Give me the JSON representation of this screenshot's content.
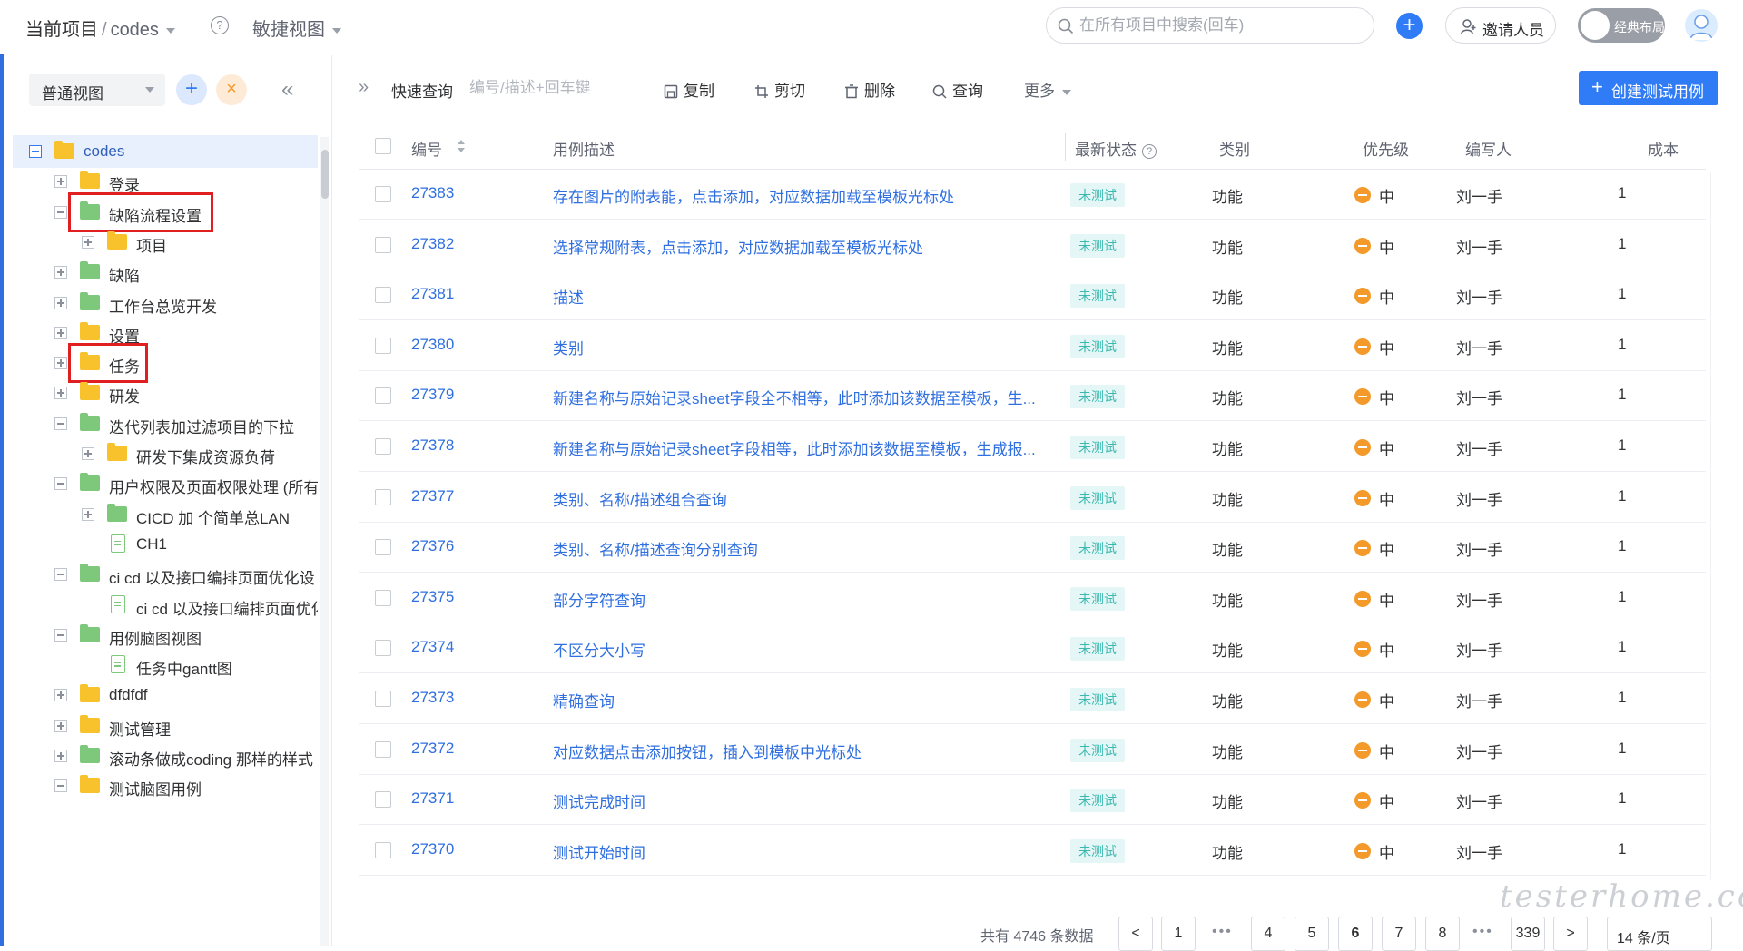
{
  "header": {
    "crumb_current": "当前项目",
    "crumb_sep": "/",
    "crumb_project": "codes",
    "help_glyph": "?",
    "agile_view": "敏捷视图",
    "search_placeholder": "在所有项目中搜索(回车)",
    "invite_label": "邀请人员",
    "layout_label": "经典布局"
  },
  "sidebar": {
    "view_select": "普通视图",
    "add_glyph": "+",
    "close_glyph": "×",
    "collapse_glyph": "«",
    "tree": [
      {
        "label": "codes",
        "level": 0,
        "icon": "folder-yellow",
        "toggle": "minus",
        "selected": true
      },
      {
        "label": "登录",
        "level": 1,
        "icon": "folder-yellow",
        "toggle": "plus"
      },
      {
        "label": "缺陷流程设置",
        "level": 1,
        "icon": "folder-green",
        "toggle": "minus",
        "highlight": true
      },
      {
        "label": "项目",
        "level": 2,
        "icon": "folder-yellow",
        "toggle": "plus"
      },
      {
        "label": "缺陷",
        "level": 1,
        "icon": "folder-green",
        "toggle": "plus"
      },
      {
        "label": "工作台总览开发",
        "level": 1,
        "icon": "folder-green",
        "toggle": "plus"
      },
      {
        "label": "设置",
        "level": 1,
        "icon": "folder-yellow",
        "toggle": "plus"
      },
      {
        "label": "任务",
        "level": 1,
        "icon": "folder-yellow",
        "toggle": "plus",
        "highlight": true
      },
      {
        "label": "研发",
        "level": 1,
        "icon": "folder-yellow",
        "toggle": "plus"
      },
      {
        "label": "迭代列表加过滤项目的下拉",
        "level": 1,
        "icon": "folder-green",
        "toggle": "minus"
      },
      {
        "label": "研发下集成资源负荷",
        "level": 2,
        "icon": "folder-yellow",
        "toggle": "plus"
      },
      {
        "label": "用户权限及页面权限处理 (所有",
        "level": 1,
        "icon": "folder-green",
        "toggle": "minus"
      },
      {
        "label": "CICD 加 个简单总LAN",
        "level": 2,
        "icon": "folder-green",
        "toggle": "plus"
      },
      {
        "label": "CH1",
        "level": 2,
        "icon": "doc",
        "toggle": "none"
      },
      {
        "label": "ci cd 以及接口编排页面优化设",
        "level": 1,
        "icon": "folder-green",
        "toggle": "minus"
      },
      {
        "label": "ci cd 以及接口编排页面优化",
        "level": 2,
        "icon": "doc",
        "toggle": "none"
      },
      {
        "label": "用例脑图视图",
        "level": 1,
        "icon": "folder-green",
        "toggle": "minus"
      },
      {
        "label": "任务中gantt图",
        "level": 2,
        "icon": "doc",
        "toggle": "none"
      },
      {
        "label": "dfdfdf",
        "level": 1,
        "icon": "folder-yellow",
        "toggle": "plus"
      },
      {
        "label": "测试管理",
        "level": 1,
        "icon": "folder-yellow",
        "toggle": "plus"
      },
      {
        "label": "滚动条做成coding 那样的样式",
        "level": 1,
        "icon": "folder-green",
        "toggle": "plus"
      },
      {
        "label": "测试脑图用例",
        "level": 1,
        "icon": "folder-yellow",
        "toggle": "minus"
      }
    ]
  },
  "toolbar": {
    "expand_glyph": "»",
    "quick_query": "快速查询",
    "quick_placeholder": "编号/描述+回车键",
    "copy": "复制",
    "cut": "剪切",
    "delete": "删除",
    "query": "查询",
    "more": "更多",
    "create_glyph": "+",
    "create": "创建测试用例"
  },
  "table": {
    "headers": {
      "id": "编号",
      "desc": "用例描述",
      "status": "最新状态",
      "category": "类别",
      "priority": "优先级",
      "author": "编写人",
      "cost": "成本"
    },
    "rows": [
      {
        "id": "27383",
        "desc": "存在图片的附表能，点击添加，对应数据加载至模板光标处",
        "status": "未测试",
        "category": "功能",
        "priority": "中",
        "author": "刘一手",
        "cost": "1"
      },
      {
        "id": "27382",
        "desc": "选择常规附表，点击添加，对应数据加载至模板光标处",
        "status": "未测试",
        "category": "功能",
        "priority": "中",
        "author": "刘一手",
        "cost": "1"
      },
      {
        "id": "27381",
        "desc": "描述",
        "status": "未测试",
        "category": "功能",
        "priority": "中",
        "author": "刘一手",
        "cost": "1"
      },
      {
        "id": "27380",
        "desc": "类别",
        "status": "未测试",
        "category": "功能",
        "priority": "中",
        "author": "刘一手",
        "cost": "1"
      },
      {
        "id": "27379",
        "desc": "新建名称与原始记录sheet字段全不相等，此时添加该数据至模板，生...",
        "status": "未测试",
        "category": "功能",
        "priority": "中",
        "author": "刘一手",
        "cost": "1"
      },
      {
        "id": "27378",
        "desc": "新建名称与原始记录sheet字段相等，此时添加该数据至模板，生成报...",
        "status": "未测试",
        "category": "功能",
        "priority": "中",
        "author": "刘一手",
        "cost": "1"
      },
      {
        "id": "27377",
        "desc": "类别、名称/描述组合查询",
        "status": "未测试",
        "category": "功能",
        "priority": "中",
        "author": "刘一手",
        "cost": "1"
      },
      {
        "id": "27376",
        "desc": "类别、名称/描述查询分别查询",
        "status": "未测试",
        "category": "功能",
        "priority": "中",
        "author": "刘一手",
        "cost": "1"
      },
      {
        "id": "27375",
        "desc": "部分字符查询",
        "status": "未测试",
        "category": "功能",
        "priority": "中",
        "author": "刘一手",
        "cost": "1"
      },
      {
        "id": "27374",
        "desc": "不区分大小写",
        "status": "未测试",
        "category": "功能",
        "priority": "中",
        "author": "刘一手",
        "cost": "1"
      },
      {
        "id": "27373",
        "desc": "精确查询",
        "status": "未测试",
        "category": "功能",
        "priority": "中",
        "author": "刘一手",
        "cost": "1"
      },
      {
        "id": "27372",
        "desc": "对应数据点击添加按钮，插入到模板中光标处",
        "status": "未测试",
        "category": "功能",
        "priority": "中",
        "author": "刘一手",
        "cost": "1"
      },
      {
        "id": "27371",
        "desc": "测试完成时间",
        "status": "未测试",
        "category": "功能",
        "priority": "中",
        "author": "刘一手",
        "cost": "1"
      },
      {
        "id": "27370",
        "desc": "测试开始时间",
        "status": "未测试",
        "category": "功能",
        "priority": "中",
        "author": "刘一手",
        "cost": "1"
      }
    ]
  },
  "pagination": {
    "total": "共有 4746 条数据",
    "prev": "<",
    "next": ">",
    "first": "1",
    "pages": [
      "4",
      "5",
      "6",
      "7",
      "8"
    ],
    "current": "6",
    "last": "339",
    "ellipsis": "•••",
    "per_page": "14 条/页"
  },
  "watermark": "testerhome.com"
}
